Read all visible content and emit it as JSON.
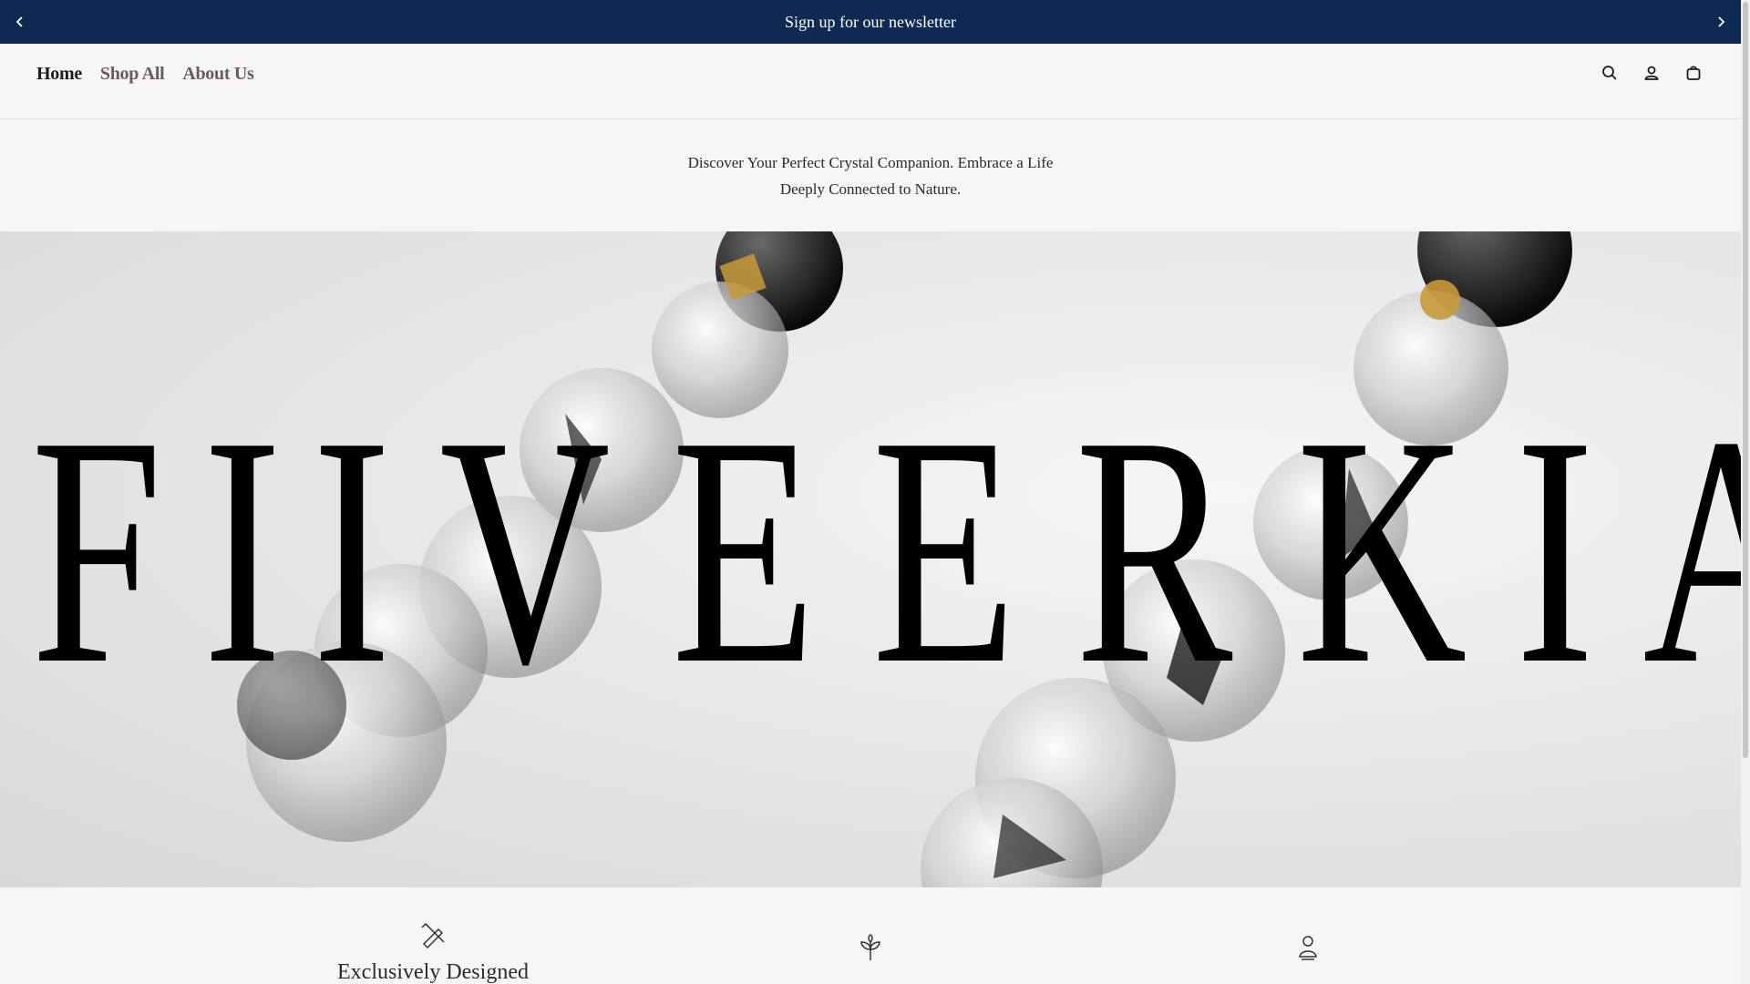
{
  "announcement": {
    "text": "Sign up for our newsletter",
    "prev_icon": "chevron-left-icon",
    "next_icon": "chevron-right-icon",
    "background": "#0e2a53"
  },
  "nav": {
    "items": [
      {
        "label": "Home",
        "active": true
      },
      {
        "label": "Shop All",
        "active": false
      },
      {
        "label": "About Us",
        "active": false
      }
    ]
  },
  "header_icons": [
    "search-icon",
    "account-icon",
    "cart-icon"
  ],
  "intro": {
    "text": "Discover Your Perfect Crystal Companion. Embrace a Life Deeply Connected to Nature."
  },
  "hero": {
    "brand": "FIIVEERKIA",
    "letters": [
      "F",
      "I",
      "I",
      "V",
      "E",
      "E",
      "R",
      "K",
      "I",
      "A"
    ]
  },
  "features": [
    {
      "title": "Exclusively Designed",
      "icon": "pencil-ruler-icon"
    },
    {
      "title": "",
      "icon": "plant-icon"
    },
    {
      "title": "",
      "icon": "person-icon"
    }
  ]
}
